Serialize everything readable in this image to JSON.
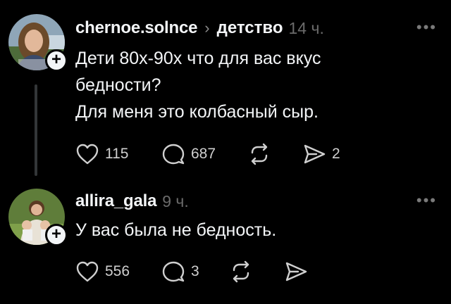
{
  "posts": [
    {
      "username": "chernoe.solnce",
      "chevron": "›",
      "topic": "детство",
      "time": "14 ч.",
      "more": "•••",
      "text_lines": [
        "Дети 80х-90х что для вас вкус",
        "бедности?",
        "Для меня это колбасный сыр."
      ],
      "likes": "115",
      "comments": "687",
      "reposts": "",
      "shares": "2",
      "icons": {
        "like": "heart-icon",
        "comment": "comment-bubble-icon",
        "repost": "repost-icon",
        "share": "send-icon"
      }
    },
    {
      "username": "allira_gala",
      "time": "9 ч.",
      "more": "•••",
      "text_lines": [
        "У вас была не бедность."
      ],
      "likes": "556",
      "comments": "3",
      "reposts": "",
      "shares": "",
      "icons": {
        "like": "heart-icon",
        "comment": "comment-bubble-icon",
        "repost": "repost-icon",
        "share": "send-icon"
      }
    }
  ],
  "colors": {
    "background": "#000000",
    "text": "#f3f5f7",
    "muted": "#6b6b6b",
    "thread_line": "#333638"
  }
}
